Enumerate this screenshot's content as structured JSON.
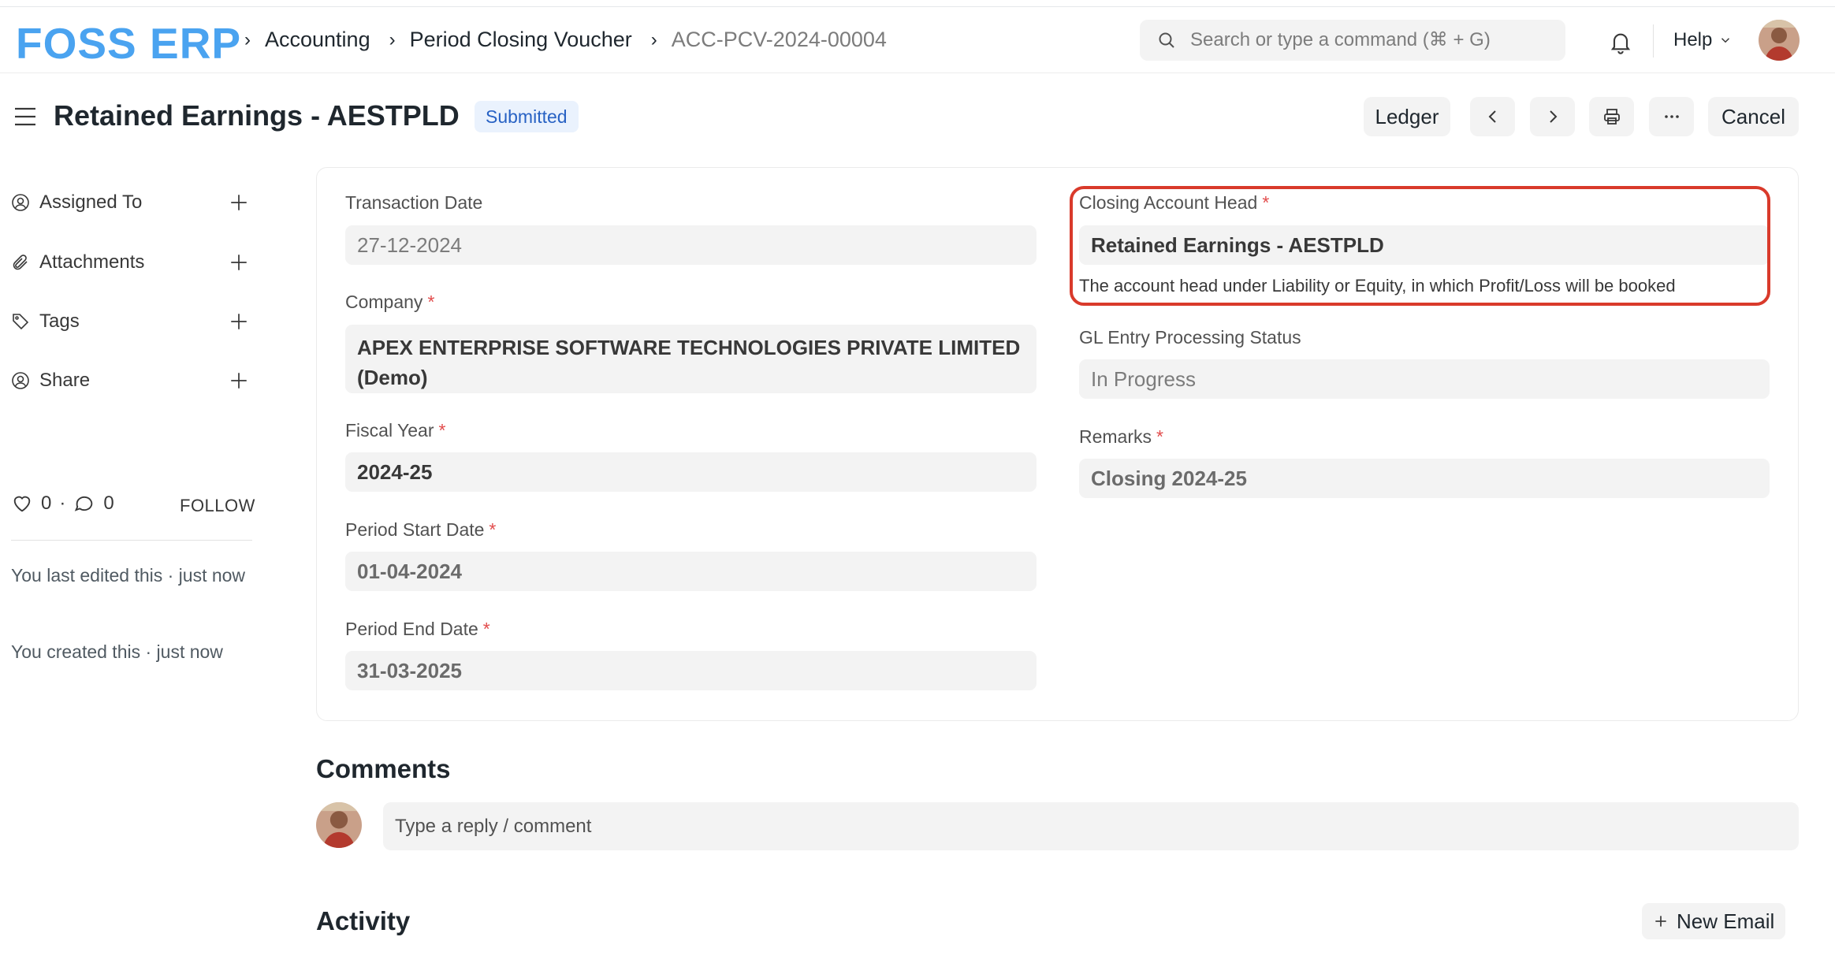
{
  "brand": {
    "logo_text": "FOSS ERP",
    "logo_color": "#4aa3f0"
  },
  "breadcrumb": {
    "items": [
      "Accounting",
      "Period Closing Voucher",
      "ACC-PCV-2024-00004"
    ]
  },
  "search": {
    "placeholder": "Search or type a command (⌘ + G)"
  },
  "navbar": {
    "help_label": "Help"
  },
  "page": {
    "title": "Retained Earnings - AESTPLD",
    "status": "Submitted",
    "status_color": "#2862c4",
    "actions": {
      "ledger": "Ledger",
      "cancel": "Cancel"
    }
  },
  "sidebar": {
    "items": [
      {
        "label": "Assigned To",
        "icon": "assign-user-icon"
      },
      {
        "label": "Attachments",
        "icon": "paperclip-icon"
      },
      {
        "label": "Tags",
        "icon": "tag-icon"
      },
      {
        "label": "Share",
        "icon": "share-user-icon"
      }
    ],
    "likes": "0",
    "comments_count": "0",
    "separator": "·",
    "follow_label": "FOLLOW",
    "last_edited": "You last edited this · just now",
    "created": "You created this · just now"
  },
  "form": {
    "left": [
      {
        "label": "Transaction Date",
        "required": false,
        "value": "27-12-2024"
      },
      {
        "label": "Company",
        "required": true,
        "value": "APEX ENTERPRISE SOFTWARE TECHNOLOGIES PRIVATE LIMITED (Demo)"
      },
      {
        "label": "Fiscal Year",
        "required": true,
        "value": "2024-25"
      },
      {
        "label": "Period Start Date",
        "required": true,
        "value": "01-04-2024"
      },
      {
        "label": "Period End Date",
        "required": true,
        "value": "31-03-2025"
      }
    ],
    "right": [
      {
        "label": "Closing Account Head",
        "required": true,
        "value": "Retained Earnings - AESTPLD",
        "description": "The account head under Liability or Equity, in which Profit/Loss will be booked"
      },
      {
        "label": "GL Entry Processing Status",
        "required": false,
        "value": "In Progress"
      },
      {
        "label": "Remarks",
        "required": true,
        "value": "Closing 2024-25"
      }
    ],
    "required_mark": "*",
    "highlight_color": "#d93a2b"
  },
  "comments": {
    "title": "Comments",
    "placeholder": "Type a reply / comment"
  },
  "activity": {
    "title": "Activity",
    "new_email_label": "New Email"
  }
}
